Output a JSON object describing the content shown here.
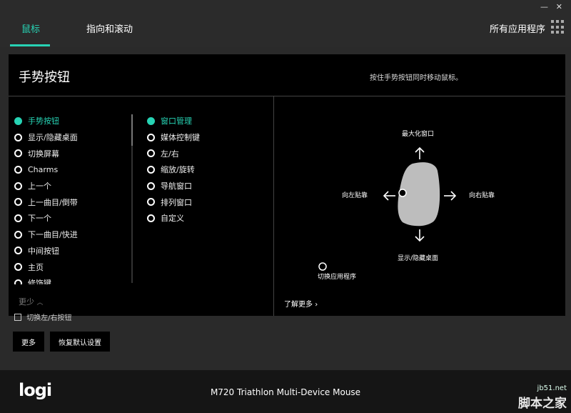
{
  "window": {
    "minimize": "—",
    "close": "✕"
  },
  "tabs": [
    {
      "label": "鼠标"
    },
    {
      "label": "指向和滚动"
    }
  ],
  "all_apps_label": "所有应用程序",
  "panel": {
    "title": "手势按钮",
    "hint": "按住手势按钮同时移动鼠标。",
    "button_list": [
      {
        "label": "手势按钮",
        "selected": true
      },
      {
        "label": "显示/隐藏桌面",
        "selected": false
      },
      {
        "label": "切换屏幕",
        "selected": false
      },
      {
        "label": "Charms",
        "selected": false
      },
      {
        "label": "上一个",
        "selected": false
      },
      {
        "label": "上一曲目/倒带",
        "selected": false
      },
      {
        "label": "下一个",
        "selected": false
      },
      {
        "label": "下一曲目/快进",
        "selected": false
      },
      {
        "label": "中间按钮",
        "selected": false
      },
      {
        "label": "主页",
        "selected": false
      },
      {
        "label": "修饰键",
        "selected": false
      }
    ],
    "less_label": "更少",
    "gesture_list": [
      {
        "label": "窗口管理",
        "selected": true
      },
      {
        "label": "媒体控制键",
        "selected": false
      },
      {
        "label": "左/右",
        "selected": false
      },
      {
        "label": "缩放/旋转",
        "selected": false
      },
      {
        "label": "导航窗口",
        "selected": false
      },
      {
        "label": "排列窗口",
        "selected": false
      },
      {
        "label": "自定义",
        "selected": false
      }
    ],
    "diagram": {
      "up": "最大化窗口",
      "left": "向左贴靠",
      "right": "向右贴靠",
      "down": "显示/隐藏桌面",
      "click": "切换应用程序"
    },
    "learn_more": "了解更多"
  },
  "behind_text": "切换左/右按钮",
  "buttons": {
    "more": "更多",
    "restore": "恢复默认设置"
  },
  "footer": {
    "logo": "logi",
    "device_name": "M720 Triathlon Multi-Device Mouse",
    "watermark_url": "jb51.net",
    "watermark_name": "脚本之家"
  },
  "colors": {
    "accent": "#27d3b4",
    "background": "#2a2a2a",
    "panel": "#000000",
    "footer": "#151515"
  }
}
